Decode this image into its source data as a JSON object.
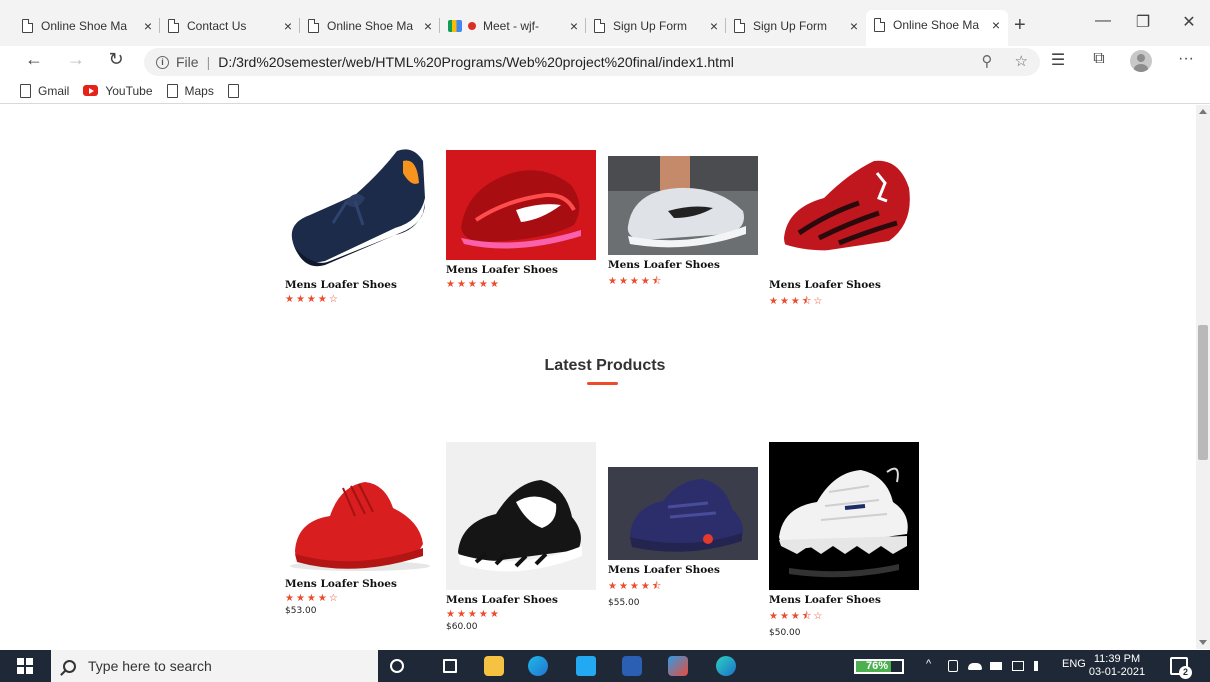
{
  "browser": {
    "tabs": [
      {
        "title": "Online Shoe Ma",
        "close": "×"
      },
      {
        "title": "Contact Us",
        "close": "×"
      },
      {
        "title": "Online Shoe Ma",
        "close": "×"
      },
      {
        "title": "Meet - wjf-",
        "close": "×"
      },
      {
        "title": "Sign Up Form",
        "close": "×"
      },
      {
        "title": "Sign Up Form",
        "close": "×"
      },
      {
        "title": "Online Shoe Ma",
        "close": "×"
      }
    ],
    "new_tab": "+",
    "window": {
      "minimize": "—",
      "restore": "❐",
      "close": "✕"
    },
    "nav": {
      "back": "←",
      "forward": "→",
      "refresh": "↻"
    },
    "address": {
      "info": "i",
      "scheme": "File",
      "separator": "|",
      "url": "D:/3rd%20semester/web/HTML%20Programs/Web%20project%20final/index1.html"
    },
    "toolbar": {
      "zoom": "⚲",
      "favorite": "☆",
      "favorites_bar": "☰",
      "collections": "⧉",
      "more": "···"
    },
    "bookmarks": [
      {
        "label": "Gmail",
        "icon": "page-icon"
      },
      {
        "label": "YouTube",
        "icon": "youtube-icon"
      },
      {
        "label": "Maps",
        "icon": "page-icon"
      },
      {
        "label": "",
        "icon": "page-icon"
      }
    ]
  },
  "page": {
    "featured": [
      {
        "name": "Mens Loafer Shoes",
        "stars": "★★★★☆",
        "price": ""
      },
      {
        "name": "Mens Loafer Shoes",
        "stars": "★★★★★",
        "price": ""
      },
      {
        "name": "Mens Loafer Shoes",
        "stars": "★★★★⯪",
        "price": ""
      },
      {
        "name": "Mens Loafer Shoes",
        "stars": "★★★⯪☆",
        "price": ""
      }
    ],
    "latest_title": "Latest Products",
    "latest": [
      {
        "name": "Mens Loafer Shoes",
        "stars": "★★★★☆",
        "price": "$53.00"
      },
      {
        "name": "Mens Loafer Shoes",
        "stars": "★★★★★",
        "price": "$60.00"
      },
      {
        "name": "Mens Loafer Shoes",
        "stars": "★★★★⯪",
        "price": "$55.00"
      },
      {
        "name": "Mens Loafer Shoes",
        "stars": "★★★⯪☆",
        "price": "$50.00"
      }
    ],
    "accent_color": "#ee4b2b"
  },
  "taskbar": {
    "search_placeholder": "Type here to search",
    "battery": {
      "label": "76%",
      "level": 0.76
    },
    "tray": {
      "chevron": "^",
      "language": "ENG"
    },
    "clock": {
      "time": "11:39 PM",
      "date": "03-01-2021"
    },
    "notifications": "2"
  }
}
